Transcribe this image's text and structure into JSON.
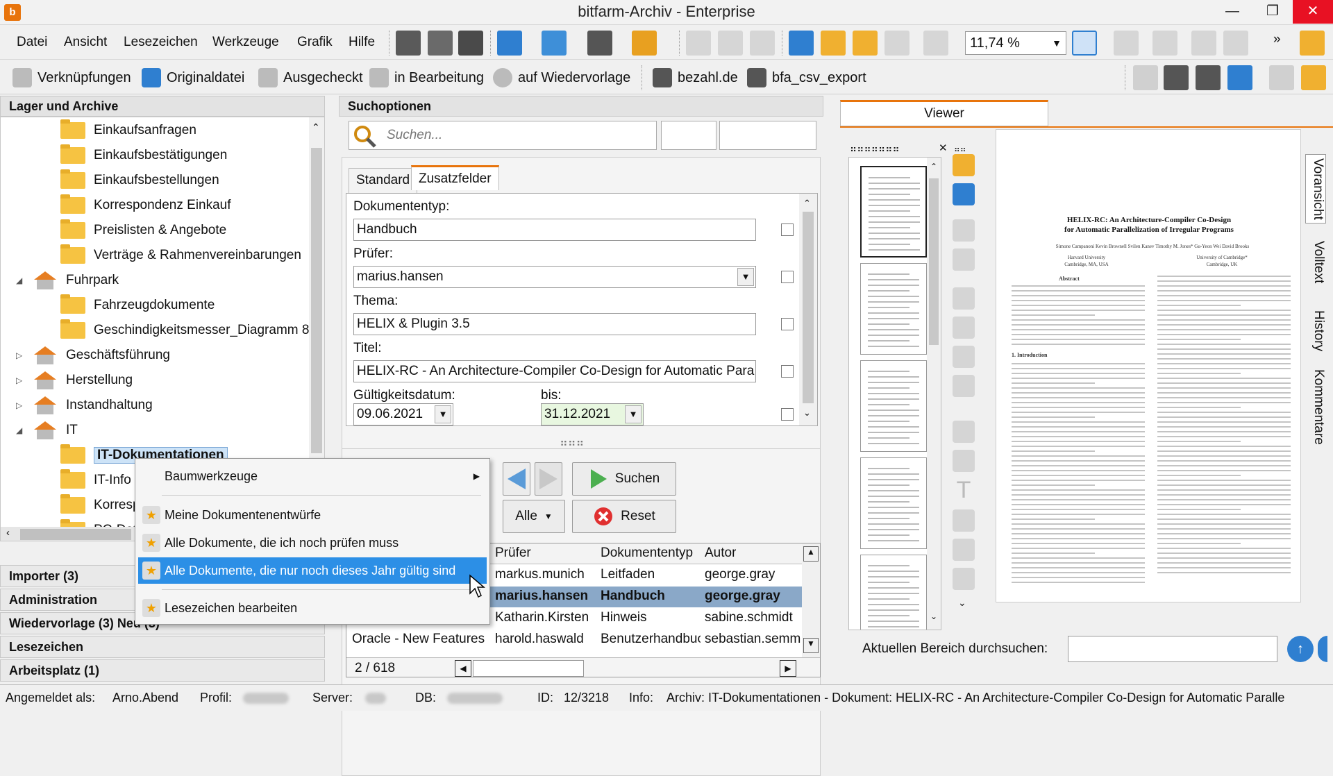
{
  "window": {
    "title": "bitfarm-Archiv - Enterprise",
    "app_icon_glyph": "b"
  },
  "menu": [
    "Datei",
    "Ansicht",
    "Lesezeichen",
    "Werkzeuge",
    "Grafik",
    "Hilfe"
  ],
  "toolbar": {
    "zoom": "11,74 %",
    "overflow": "»"
  },
  "toolbar2": {
    "links": "Verknüpfungen",
    "original": "Originaldatei",
    "checked_out": "Ausgecheckt",
    "in_edit": "in Bearbeitung",
    "resubmit": "auf Wiedervorlage",
    "bezahl": "bezahl.de",
    "csv": "bfa_csv_export"
  },
  "left": {
    "header": "Lager und Archive",
    "tree": [
      {
        "label": "Einkaufsanfragen",
        "type": "folder",
        "indent": 1
      },
      {
        "label": "Einkaufsbestätigungen",
        "type": "folder",
        "indent": 1
      },
      {
        "label": "Einkaufsbestellungen",
        "type": "folder",
        "indent": 1
      },
      {
        "label": "Korrespondenz Einkauf",
        "type": "folder",
        "indent": 1
      },
      {
        "label": "Preislisten & Angebote",
        "type": "folder",
        "indent": 1
      },
      {
        "label": "Verträge & Rahmenvereinbarungen",
        "type": "folder",
        "indent": 1
      },
      {
        "label": "Fuhrpark",
        "type": "house",
        "indent": 0,
        "expander": "◢"
      },
      {
        "label": "Fahrzeugdokumente",
        "type": "folder",
        "indent": 1
      },
      {
        "label": "Geschindigkeitsmesser_Diagramm 8",
        "type": "folder",
        "indent": 1
      },
      {
        "label": "Geschäftsführung",
        "type": "house",
        "indent": 0,
        "expander": "▷"
      },
      {
        "label": "Herstellung",
        "type": "house",
        "indent": 0,
        "expander": "▷"
      },
      {
        "label": "Instandhaltung",
        "type": "house",
        "indent": 0,
        "expander": "▷"
      },
      {
        "label": "IT",
        "type": "house",
        "indent": 0,
        "expander": "◢"
      },
      {
        "label": "IT-Dokumentationen",
        "type": "folder-open",
        "indent": 1,
        "selected": true
      },
      {
        "label": "IT-Info",
        "type": "folder",
        "indent": 1
      },
      {
        "label": "Korresp",
        "type": "folder",
        "indent": 1
      },
      {
        "label": "PC-Dat",
        "type": "folder",
        "indent": 1
      }
    ],
    "accordion": [
      "Importer (3)",
      "Administration",
      "Wiedervorlage (3)  Neu (3)",
      "Lesezeichen",
      "Arbeitsplatz (1)"
    ]
  },
  "search": {
    "header": "Suchoptionen",
    "placeholder": "Suchen...",
    "tabs": [
      "Standard",
      "Zusatzfelder"
    ],
    "fields": {
      "doctype_label": "Dokumententyp:",
      "doctype_value": "Handbuch",
      "reviewer_label": "Prüfer:",
      "reviewer_value": "marius.hansen",
      "topic_label": "Thema:",
      "topic_value": "HELIX & Plugin 3.5",
      "title_label": "Titel:",
      "title_value": "HELIX-RC - An Architecture-Compiler Co-Design for Automatic Para",
      "valid_label": "Gültigkeitsdatum:",
      "valid_from": "09.06.2021",
      "to_label": "bis:",
      "valid_to": "31.12.2021"
    },
    "search_btn": "Suchen",
    "all_btn": "Alle",
    "reset_btn": "Reset"
  },
  "results": {
    "headers": [
      "Prüfer",
      "Dokumententyp",
      "Autor"
    ],
    "rows": [
      {
        "title": "",
        "reviewer": "markus.munich",
        "type": "Leitfaden",
        "author": "george.gray"
      },
      {
        "title": "",
        "reviewer": "marius.hansen",
        "type": "Handbuch",
        "author": "george.gray",
        "selected": true
      },
      {
        "title": "",
        "reviewer": "Katharin.Kirsten",
        "type": "Hinweis",
        "author": "sabine.schmidt"
      },
      {
        "title": "Oracle - New Features f",
        "reviewer": "harold.haswald",
        "type": "Benutzerhandbuc",
        "author": "sebastian.semm"
      }
    ],
    "pager": "2 / 618"
  },
  "context_menu": {
    "tree_tools": "Baumwerkzeuge",
    "items": [
      "Meine Dokumentenentwürfe",
      "Alle Dokumente, die ich noch prüfen muss",
      "Alle Dokumente, die nur noch dieses Jahr gültig sind"
    ],
    "edit": "Lesezeichen bearbeiten"
  },
  "viewer": {
    "tab": "Viewer",
    "vtabs": [
      "Voransicht",
      "Volltext",
      "History",
      "Kommentare"
    ],
    "search_label": "Aktuellen Bereich durchsuchen:",
    "page": {
      "title1": "HELIX-RC: An Architecture-Compiler Co-Design",
      "title2": "for Automatic Parallelization of Irregular Programs",
      "authors": "Simone Campanoni    Kevin Brownell    Svilen Kanev    Timothy M. Jones*    Gu-Yeon Wei    David Brooks",
      "affil_left": "Harvard University",
      "affil_left2": "Cambridge, MA, USA",
      "affil_right": "University of Cambridge*",
      "affil_right2": "Cambridge, UK",
      "abstract": "Abstract",
      "intro": "1. Introduction"
    }
  },
  "status": {
    "logged_label": "Angemeldet als:",
    "logged_value": "Arno.Abend",
    "profile_label": "Profil:",
    "server_label": "Server:",
    "db_label": "DB:",
    "id_label": "ID:",
    "id_value": "12/3218",
    "info_label": "Info:",
    "info_value": "Archiv: IT-Dokumentationen - Dokument: HELIX-RC - An Architecture-Compiler Co-Design for Automatic Paralle"
  }
}
